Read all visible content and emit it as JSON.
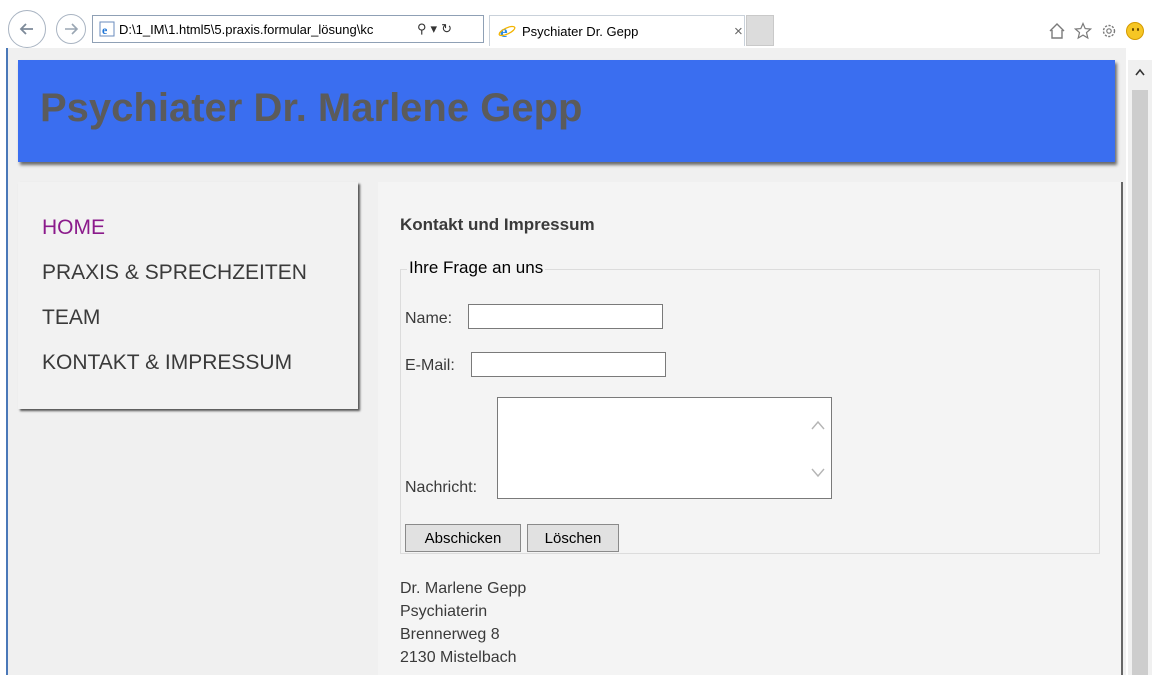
{
  "browser": {
    "address": "D:\\1_IM\\1.html5\\5.praxis.formular_lösung\\kc",
    "search_glyph": "⚲",
    "dropdown_glyph": "▾",
    "refresh_glyph": "↻",
    "tab_title": "Psychiater Dr. Gepp",
    "tab_close": "×",
    "icons": [
      "home-icon",
      "star-icon",
      "gear-icon",
      "smiley-icon"
    ]
  },
  "page": {
    "title": "Psychiater Dr. Marlene Gepp",
    "header_color": "#3a6ef0",
    "nav": [
      {
        "label": "HOME",
        "active": true
      },
      {
        "label": "PRAXIS & SPRECHZEITEN",
        "active": false
      },
      {
        "label": "TEAM",
        "active": false
      },
      {
        "label": "KONTAKT & IMPRESSUM",
        "active": false
      }
    ],
    "section_title": "Kontakt und Impressum",
    "form": {
      "legend": "Ihre Frage an uns",
      "name_label": "Name:",
      "name_value": "",
      "email_label": "E-Mail:",
      "email_value": "",
      "message_label": "Nachricht:",
      "message_value": "",
      "submit_label": "Abschicken",
      "reset_label": "Löschen"
    },
    "address": [
      "Dr. Marlene Gepp",
      "Psychiaterin",
      "Brennerweg 8",
      "2130 Mistelbach"
    ]
  }
}
